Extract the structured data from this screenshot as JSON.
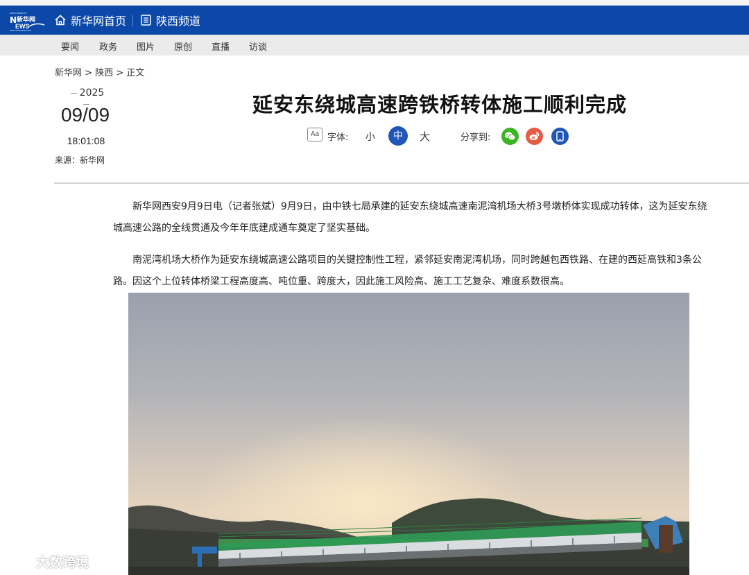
{
  "header": {
    "logo_text": "新华网",
    "home_label": "新华网首页",
    "channel_label": "陕西频道"
  },
  "subnav": {
    "items": [
      "要闻",
      "政务",
      "图片",
      "原创",
      "直播",
      "访谈"
    ]
  },
  "breadcrumb": {
    "items": [
      "新华网",
      "陕西",
      "正文"
    ],
    "separator": ">"
  },
  "article": {
    "year": "2025",
    "month_day": "09/09",
    "time": "18:01:08",
    "source": "来源：新华网",
    "title": "延安东绕城高速跨铁桥转体施工顺利完成",
    "paragraphs": [
      "新华网西安9月9日电（记者张斌）9月9日，由中铁七局承建的延安东绕城高速南泥湾机场大桥3号墩桥体实现成功转体，这为延安东绕城高速公路的全线贯通及今年年底建成通车奠定了坚实基础。",
      "南泥湾机场大桥作为延安东绕城高速公路项目的关键控制性工程，紧邻延安南泥湾机场，同时跨越包西铁路、在建的西延高铁和3条公路。因这个上位转体桥梁工程高度高、吨位重、跨度大，因此施工风险高、施工工艺复杂、难度系数很高。"
    ]
  },
  "toolbar": {
    "font_label": "字体:",
    "font_small": "小",
    "font_medium": "中",
    "font_large": "大",
    "share_label": "分享到:"
  },
  "watermark": {
    "text": "大数跨境"
  },
  "colors": {
    "header_bg": "#0b48a8",
    "accent": "#1f56b8",
    "wechat": "#3bb523",
    "weibo": "#e65b46"
  }
}
